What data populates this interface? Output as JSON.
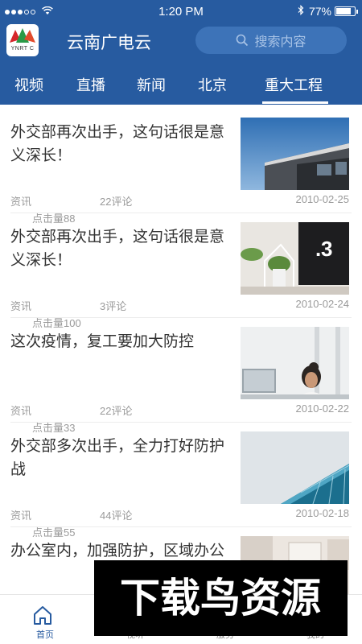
{
  "status_bar": {
    "time": "1:20 PM",
    "battery": "77%",
    "battery_level": 0.77
  },
  "header": {
    "logo_text": "YNRT C",
    "app_title": "云南广电云",
    "search_placeholder": "搜索内容",
    "search_icon": "search-icon"
  },
  "tabs": [
    {
      "label": "视频"
    },
    {
      "label": "直播"
    },
    {
      "label": "新闻"
    },
    {
      "label": "北京"
    },
    {
      "label": "重大工程",
      "active": true
    }
  ],
  "articles": [
    {
      "title": "外交部再次出手，这句话很是意义深长！",
      "category": "资讯",
      "comments": "22评论",
      "date": "2010-02-25",
      "clicks": "点击量88",
      "image": "building-photo"
    },
    {
      "title": "外交部再次出手，这句话很是意义深长！",
      "category": "资讯",
      "comments": "3评论",
      "date": "2010-02-24",
      "clicks": "点击量100",
      "image": "desk-photo"
    },
    {
      "title": "这次疫情，复工要加大防控",
      "category": "资讯",
      "comments": "22评论",
      "date": "2010-02-22",
      "clicks": "点击量33",
      "image": "office-photo"
    },
    {
      "title": "外交部多次出手，全力打好防护战",
      "category": "资讯",
      "comments": "44评论",
      "date": "2010-02-18",
      "clicks": "点击量55",
      "image": "glass-building-photo"
    },
    {
      "title": "办公室内，加强防护，区域办公",
      "image": "interior-photo"
    }
  ],
  "bottom_nav": [
    {
      "label": "首页",
      "icon": "home-icon",
      "active": true
    },
    {
      "label": "视听",
      "icon": "play-icon"
    },
    {
      "label": "服务",
      "icon": "grid-icon"
    },
    {
      "label": "我的",
      "icon": "user-icon"
    }
  ],
  "watermark": {
    "text": "下载鸟资源"
  },
  "colors": {
    "brand": "#275ba0",
    "text": "#333333",
    "meta": "#9a9a9a"
  }
}
